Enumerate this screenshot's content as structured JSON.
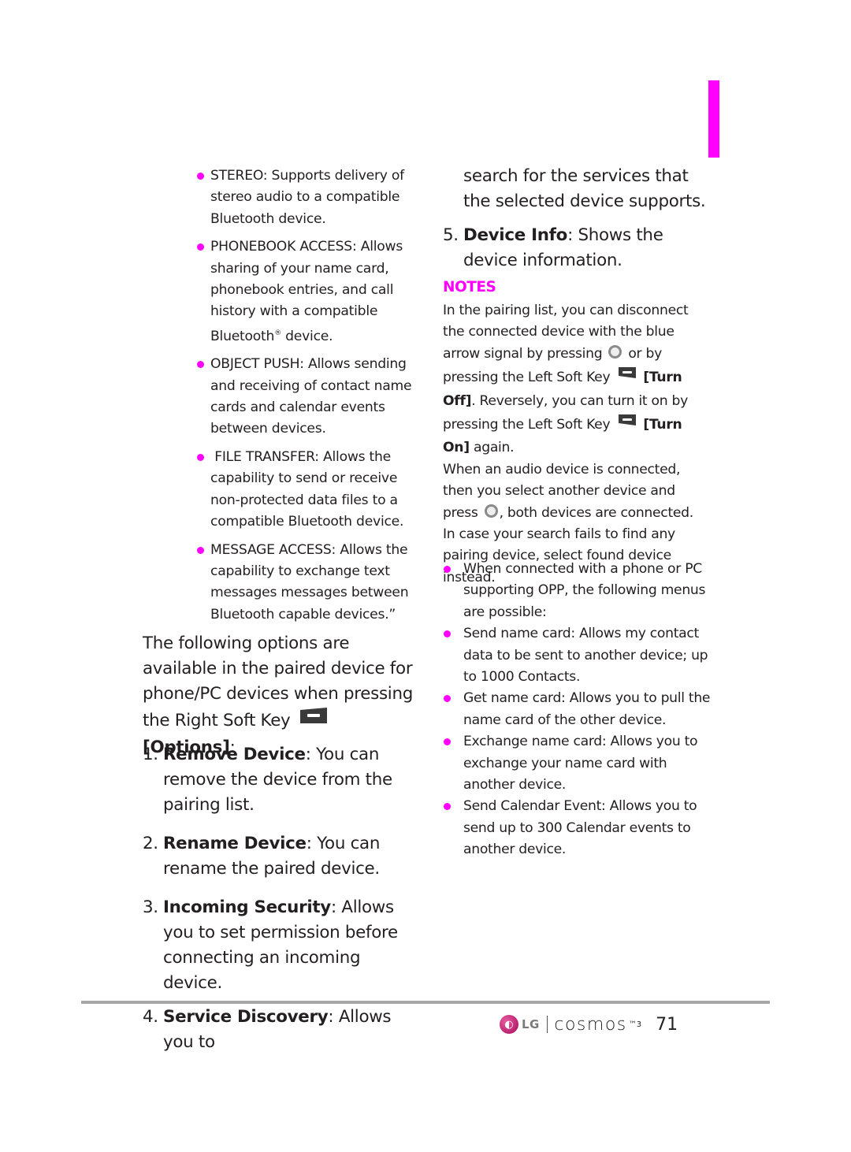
{
  "left_bullets": [
    {
      "text": "STEREO: Supports delivery of stereo audio to a compatible Bluetooth device."
    },
    {
      "text_before": "PHONEBOOK ACCESS: Allows sharing of your name card, phonebook entries, and call history with a compatible Bluetooth",
      "reg": "®",
      "text_after": " device."
    },
    {
      "text": "OBJECT PUSH: Allows sending and receiving of contact name cards and calendar events between devices."
    },
    {
      "text": " FILE TRANSFER: Allows the capability to send or receive non-protected data files to a compatible Bluetooth device."
    },
    {
      "text": "MESSAGE ACCESS: Allows the capability to exchange text messages messages between Bluetooth capable devices.”"
    }
  ],
  "intro": {
    "text": "The following options are available in the paired device for phone/PC devices when pressing the Right Soft Key",
    "key_icon": "right-soft-key-icon",
    "key_label": "[Options]",
    "suffix": ":"
  },
  "options": [
    {
      "num": "1.",
      "term": "Remove Device",
      "desc": ": You can remove the device from the pairing list."
    },
    {
      "num": "2.",
      "term": "Rename Device",
      "desc": ": You can rename the paired device."
    },
    {
      "num": "3.",
      "term": "Incoming Security",
      "desc": ": Allows you to set permission before connecting an incoming device."
    },
    {
      "num": "4.",
      "term": "Service Discovery",
      "desc": ": Allows you to"
    }
  ],
  "option4_continued": "search for the services that the selected device supports.",
  "option5": {
    "num": "5.",
    "term": "Device Info",
    "desc": ": Shows the device information."
  },
  "notes": {
    "title": "NOTES",
    "p1_a": "In the pairing list, you can disconnect the connected device with the blue arrow signal by pressing",
    "ok_icon": "ok-key-icon",
    "p1_b": "or by pressing the Left Soft Key",
    "left_key_icon": "left-soft-key-icon",
    "p1_turn_off": "[Turn Off]",
    "p1_c": ". Reversely, you can turn it on by pressing the Left Soft Key",
    "p1_turn_on": "[Turn On]",
    "p1_d": " again.",
    "p2_a": "When an audio device is connected, then you select another device and press",
    "p2_b": ", both devices are connected.",
    "p3": "In case your search fails to find any pairing device, select found device instead.",
    "bullets": [
      "When connected with a phone or PC supporting OPP, the following  menus are possible:",
      "Send name card: Allows my contact data to be sent to another device; up to 1000 Contacts.",
      "Get name card: Allows you to pull the name card of the other device.",
      "Exchange name card: Allows you to exchange your name card with another device.",
      "Send Calendar Event: Allows you to send up to 300 Calendar events to another device."
    ]
  },
  "footer": {
    "logo_text": "LG",
    "brand": "cosmos",
    "brand_sup": "™3",
    "page_number": "71"
  },
  "colors": {
    "accent": "#ff00ff",
    "rule": "#a6a6a6",
    "text": "#231f20"
  }
}
